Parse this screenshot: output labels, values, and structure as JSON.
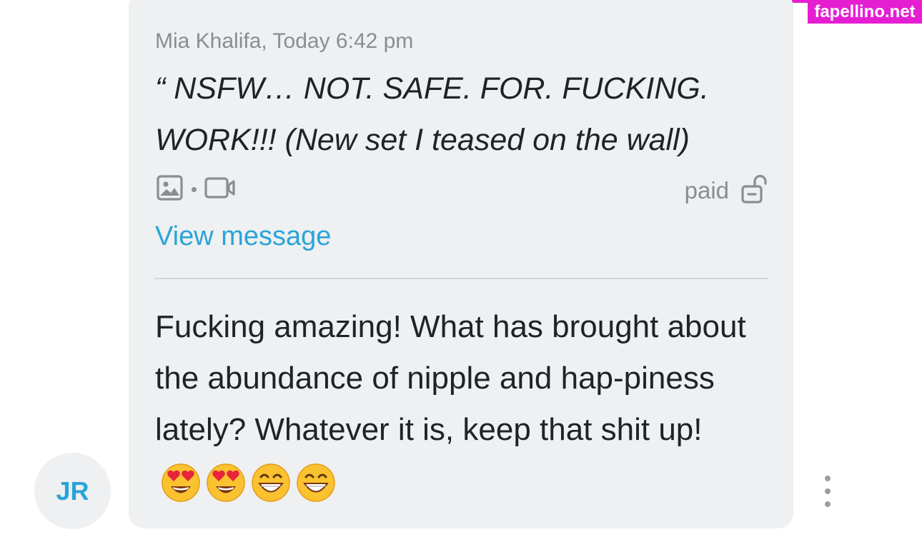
{
  "quoted_message": {
    "meta": "Mia Khalifa, Today 6:42 pm",
    "text": "“ NSFW… NOT. SAFE. FOR. FUCKING. WORK!!! (New set I teased on the wall)",
    "media_icons": [
      "image-icon",
      "video-icon"
    ],
    "paid_label": "paid",
    "lock_icon": "unlocked-lock-icon",
    "view_link": "View message"
  },
  "reply": {
    "text": "Fucking amazing! What has brought about the abundance of nipple and hap-piness lately? Whatever it is, keep that shit up!",
    "emojis": [
      "heart-eyes-emoji",
      "heart-eyes-emoji",
      "grinning-emoji",
      "grinning-emoji"
    ]
  },
  "sender": {
    "avatar_initials": "JR"
  },
  "watermark": {
    "text": "fapellino.net"
  },
  "colors": {
    "bubble": "#eef0f1",
    "link": "#2aa4d8",
    "muted": "#8a8d91",
    "text": "#1f2326",
    "watermark_bg": "#e61ed2"
  }
}
